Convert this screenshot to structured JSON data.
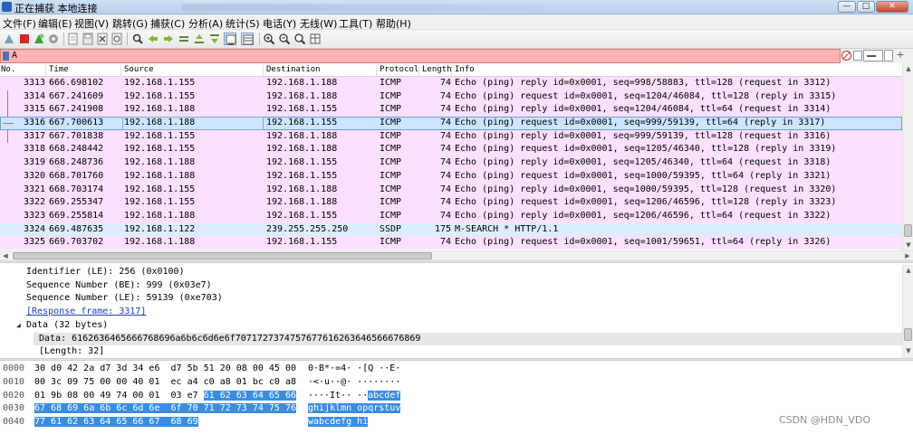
{
  "window": {
    "title": "正在捕获 本地连接",
    "buttons": [
      "—",
      "□",
      "✕"
    ]
  },
  "menu": [
    "文件(F)",
    "编辑(E)",
    "视图(V)",
    "跳转(G)",
    "捕获(C)",
    "分析(A)",
    "统计(S)",
    "电话(Y)",
    "无线(W)",
    "工具(T)",
    "帮助(H)"
  ],
  "toolbar_icons": [
    "shark-fin-start-icon",
    "stop-icon",
    "restart-icon",
    "options-gear-icon",
    "open-file-icon",
    "save-file-icon",
    "close-file-icon",
    "reload-icon",
    "find-icon",
    "go-back-icon",
    "go-forward-icon",
    "go-to-packet-icon",
    "go-first-icon",
    "go-last-icon",
    "autoscroll-icon",
    "colorize-icon",
    "zoom-in-icon",
    "zoom-out-icon",
    "zoom-normal-icon",
    "resize-columns-icon"
  ],
  "filter": {
    "value": "A"
  },
  "packet_list": {
    "columns": [
      "No.",
      "Time",
      "Source",
      "Destination",
      "Protocol",
      "Length",
      "Info"
    ],
    "rows": [
      {
        "no": "3313",
        "time": "666.698102",
        "src": "192.168.1.155",
        "dst": "192.168.1.188",
        "proto": "ICMP",
        "len": "74",
        "info": "Echo (ping) reply    id=0x0001, seq=998/58883, ttl=128 (request in 3312)",
        "kind": "icmp"
      },
      {
        "no": "3314",
        "time": "667.241609",
        "src": "192.168.1.155",
        "dst": "192.168.1.188",
        "proto": "ICMP",
        "len": "74",
        "info": "Echo (ping) request  id=0x0001, seq=1204/46084, ttl=128 (reply in 3315)",
        "kind": "icmp"
      },
      {
        "no": "3315",
        "time": "667.241908",
        "src": "192.168.1.188",
        "dst": "192.168.1.155",
        "proto": "ICMP",
        "len": "74",
        "info": "Echo (ping) reply    id=0x0001, seq=1204/46084, ttl=64 (request in 3314)",
        "kind": "icmp"
      },
      {
        "no": "3316",
        "time": "667.700613",
        "src": "192.168.1.188",
        "dst": "192.168.1.155",
        "proto": "ICMP",
        "len": "74",
        "info": "Echo (ping) request  id=0x0001, seq=999/59139, ttl=64 (reply in 3317)",
        "kind": "selected"
      },
      {
        "no": "3317",
        "time": "667.701838",
        "src": "192.168.1.155",
        "dst": "192.168.1.188",
        "proto": "ICMP",
        "len": "74",
        "info": "Echo (ping) reply    id=0x0001, seq=999/59139, ttl=128 (request in 3316)",
        "kind": "icmp"
      },
      {
        "no": "3318",
        "time": "668.248442",
        "src": "192.168.1.155",
        "dst": "192.168.1.188",
        "proto": "ICMP",
        "len": "74",
        "info": "Echo (ping) request  id=0x0001, seq=1205/46340, ttl=128 (reply in 3319)",
        "kind": "icmp"
      },
      {
        "no": "3319",
        "time": "668.248736",
        "src": "192.168.1.188",
        "dst": "192.168.1.155",
        "proto": "ICMP",
        "len": "74",
        "info": "Echo (ping) reply    id=0x0001, seq=1205/46340, ttl=64 (request in 3318)",
        "kind": "icmp"
      },
      {
        "no": "3320",
        "time": "668.701760",
        "src": "192.168.1.188",
        "dst": "192.168.1.155",
        "proto": "ICMP",
        "len": "74",
        "info": "Echo (ping) request  id=0x0001, seq=1000/59395, ttl=64 (reply in 3321)",
        "kind": "icmp"
      },
      {
        "no": "3321",
        "time": "668.703174",
        "src": "192.168.1.155",
        "dst": "192.168.1.188",
        "proto": "ICMP",
        "len": "74",
        "info": "Echo (ping) reply    id=0x0001, seq=1000/59395, ttl=128 (request in 3320)",
        "kind": "icmp"
      },
      {
        "no": "3322",
        "time": "669.255347",
        "src": "192.168.1.155",
        "dst": "192.168.1.188",
        "proto": "ICMP",
        "len": "74",
        "info": "Echo (ping) request  id=0x0001, seq=1206/46596, ttl=128 (reply in 3323)",
        "kind": "icmp"
      },
      {
        "no": "3323",
        "time": "669.255814",
        "src": "192.168.1.188",
        "dst": "192.168.1.155",
        "proto": "ICMP",
        "len": "74",
        "info": "Echo (ping) reply    id=0x0001, seq=1206/46596, ttl=64 (request in 3322)",
        "kind": "icmp"
      },
      {
        "no": "3324",
        "time": "669.487635",
        "src": "192.168.1.122",
        "dst": "239.255.255.250",
        "proto": "SSDP",
        "len": "175",
        "info": "M-SEARCH * HTTP/1.1",
        "kind": "udp"
      },
      {
        "no": "3325",
        "time": "669.703702",
        "src": "192.168.1.188",
        "dst": "192.168.1.155",
        "proto": "ICMP",
        "len": "74",
        "info": "Echo (ping) request  id=0x0001, seq=1001/59651, ttl=64 (reply in 3326)",
        "kind": "icmp"
      }
    ]
  },
  "details": {
    "lines": [
      {
        "text": "Identifier (LE): 256 (0x0100)",
        "indent": 1,
        "kind": "plain"
      },
      {
        "text": "Sequence Number (BE): 999 (0x03e7)",
        "indent": 1,
        "kind": "plain"
      },
      {
        "text": "Sequence Number (LE): 59139 (0xe703)",
        "indent": 1,
        "kind": "plain"
      },
      {
        "text": "[Response frame: 3317]",
        "indent": 1,
        "kind": "link"
      },
      {
        "text": "Data (32 bytes)",
        "indent": 1,
        "kind": "expanded"
      },
      {
        "text": "Data: 6162636465666768696a6b6c6d6e6f7071727374757677616263646566676869",
        "indent": 2,
        "kind": "selected"
      },
      {
        "text": "[Length: 32]",
        "indent": 2,
        "kind": "plain"
      }
    ]
  },
  "bytes": {
    "lines": [
      {
        "offset": "0000",
        "hex_plain": "30 d0 42 2a d7 3d 34 e6  d7 5b 51 20 08 00 45 00",
        "hex_hl": "",
        "hex_rest": "",
        "ascii_plain": "0·B*·=4· ·[Q ··E·",
        "ascii_hl": ""
      },
      {
        "offset": "0010",
        "hex_plain": "00 3c 09 75 00 00 40 01  ec a4 c0 a8 01 bc c0 a8",
        "hex_hl": "",
        "hex_rest": "",
        "ascii_plain": "·<·u··@· ········",
        "ascii_hl": ""
      },
      {
        "offset": "0020",
        "hex_plain": "01 9b 08 00 49 74 00 01  03 e7 ",
        "hex_hl": "61 62 63 64 65 66",
        "hex_rest": "",
        "ascii_plain": "····It·· ··",
        "ascii_hl": "abcdef"
      },
      {
        "offset": "0030",
        "hex_plain": "",
        "hex_hl": "67 68 69 6a 6b 6c 6d 6e  6f 70 71 72 73 74 75 76",
        "hex_rest": "",
        "ascii_plain": "",
        "ascii_hl": "ghijklmn opqrstuv"
      },
      {
        "offset": "0040",
        "hex_plain": "",
        "hex_hl": "77 61 62 63 64 65 66 67  68 69",
        "hex_rest": "",
        "ascii_plain": "",
        "ascii_hl": "wabcdefg hi"
      }
    ]
  },
  "watermark": "CSDN @HDN_VDO"
}
